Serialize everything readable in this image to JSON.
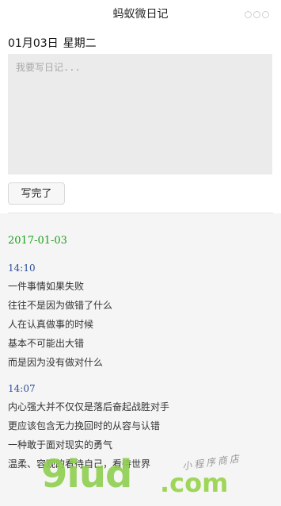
{
  "title": "蚂蚁微日记",
  "header": {
    "date": "01月03日",
    "weekday": "星期二"
  },
  "editor": {
    "placeholder": "我要写日记..."
  },
  "done_button": "写完了",
  "entries_date": "2017-01-03",
  "entries": [
    {
      "time": "14:10",
      "lines": [
        "一件事情如果失败",
        "往往不是因为做错了什么",
        "人在认真做事的时候",
        "基本不可能出大错",
        "而是因为没有做对什么"
      ]
    },
    {
      "time": "14:07",
      "lines": [
        "内心强大并不仅仅是落后奋起战胜对手",
        "更应该包含无力挽回时的从容与认错",
        "一种敢于面对现实的勇气",
        "温柔、容观的看待自己，看待世界"
      ]
    }
  ],
  "watermark": {
    "main": "9iud",
    "domain": ".com",
    "tagline": "小程序商店"
  },
  "colors": {
    "date_green": "#1aa01a",
    "time_blue": "#2d4f99",
    "watermark_green": "#8fcf4f"
  }
}
